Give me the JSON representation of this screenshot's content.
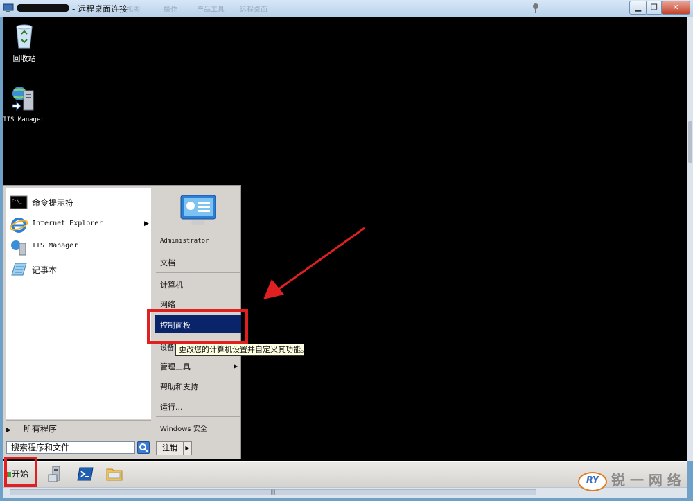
{
  "window": {
    "title": "- 远程桌面连接",
    "menus_faded": [
      "视图",
      "操作",
      "产品工具",
      "远程桌面"
    ],
    "controls": {
      "minimize": "▁",
      "restore": "❐",
      "close": "✕"
    }
  },
  "desktop": {
    "icons": [
      {
        "label": "回收站",
        "icon": "recycle-bin-icon"
      },
      {
        "label": "IIS Manager",
        "icon": "iis-manager-icon"
      }
    ]
  },
  "start_menu": {
    "left_items": [
      {
        "label": "命令提示符",
        "icon": "cmd-icon"
      },
      {
        "label": "Internet Explorer",
        "icon": "ie-icon",
        "submenu": true
      },
      {
        "label": "IIS Manager",
        "icon": "iis-manager-icon"
      },
      {
        "label": "记事本",
        "icon": "notepad-icon"
      }
    ],
    "all_programs": "所有程序",
    "search_placeholder": "搜索程序和文件",
    "right_items": {
      "user": "Administrator",
      "documents": "文档",
      "computer": "计算机",
      "network": "网络",
      "control_panel": "控制面板",
      "devices_partial": "设备和",
      "admin_tools": "管理工具",
      "help": "帮助和支持",
      "run": "运行...",
      "windows_security": "Windows 安全"
    },
    "logoff": "注销",
    "tooltip": "更改您的计算机设置并自定义其功能。"
  },
  "taskbar": {
    "start_label": "开始",
    "pinned": [
      "server-manager-icon",
      "powershell-icon",
      "explorer-icon"
    ]
  },
  "watermark": {
    "badge": "RY",
    "text": "锐 一 网 络"
  },
  "colors": {
    "highlight": "#0a246a",
    "annotation": "#e02020",
    "desktop": "#000000"
  }
}
